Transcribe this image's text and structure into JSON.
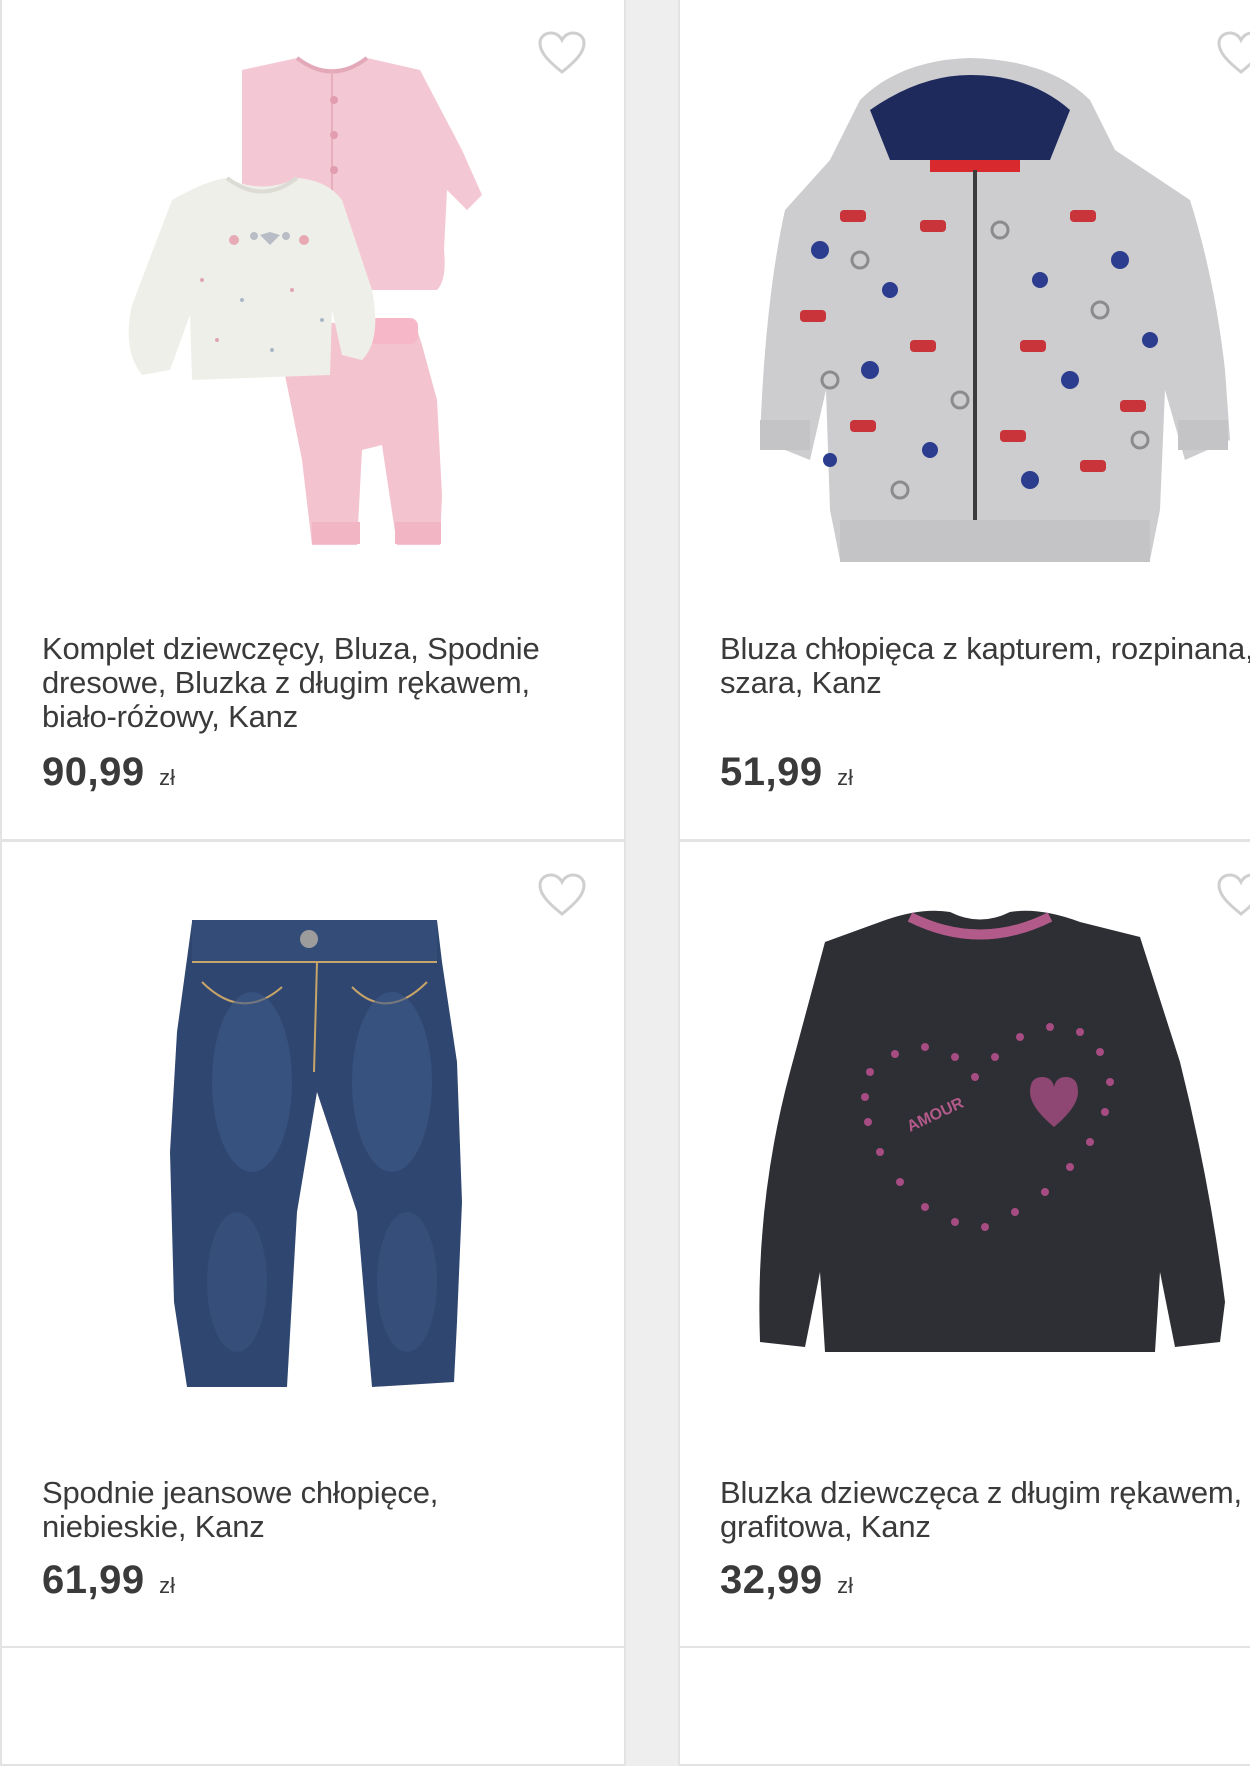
{
  "products": [
    {
      "title": "Komplet dziewczęcy, Bluza, Spodnie dresowe, Bluzka z długim rękawem, biało-różowy, Kanz",
      "price": "90,99",
      "currency": "zł",
      "favorite_icon": "heart-outline-icon",
      "image": "pink-white-baby-set"
    },
    {
      "title": "Bluza chłopięca z kapturem, rozpinana, szara, Kanz",
      "price": "51,99",
      "currency": "zł",
      "favorite_icon": "heart-outline-icon",
      "image": "grey-hoodie"
    },
    {
      "title": "Spodnie jeansowe chłopięce, niebieskie, Kanz",
      "price": "61,99",
      "currency": "zł",
      "favorite_icon": "heart-outline-icon",
      "image": "blue-jeans"
    },
    {
      "title": "Bluzka dziewczęca z długim rękawem, grafitowa, Kanz",
      "price": "32,99",
      "currency": "zł",
      "favorite_icon": "heart-outline-icon",
      "image": "graphite-long-sleeve"
    }
  ],
  "colors": {
    "background": "#eeeeee",
    "card": "#ffffff",
    "text": "#3a3a3a",
    "heart_outline": "#cfcfcf"
  }
}
